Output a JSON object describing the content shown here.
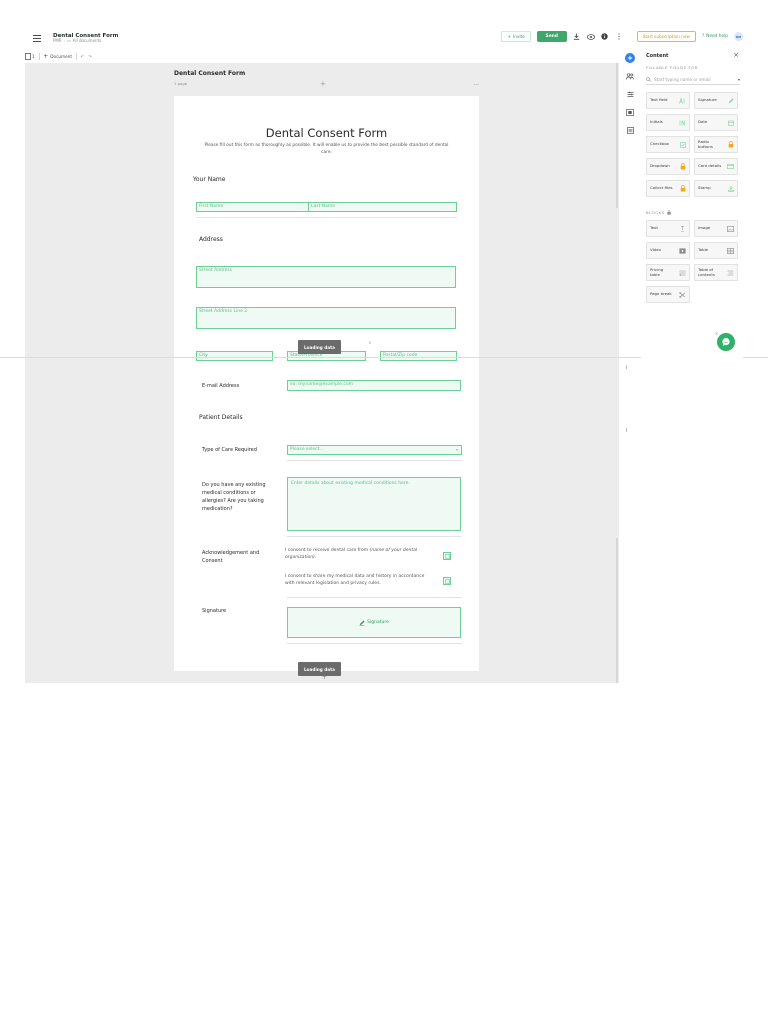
{
  "app": {
    "doc_title": "Dental Consent Form",
    "breadcrumb": [
      "PMR",
      "All documents"
    ]
  },
  "topbar": {
    "invite_label": "Invite",
    "send_label": "Send",
    "subscribe_label": "Start subscription now",
    "help_label": "Need help",
    "avatar_initials": "NH",
    "icons": [
      "download-icon",
      "preview-icon",
      "info-icon",
      "more-vert-icon"
    ]
  },
  "toolbar": {
    "pages_count": "1",
    "document_label": "Document"
  },
  "canvas": {
    "doc_name": "Dental Consent Form",
    "page_count_label": "1 page",
    "loading_label": "Loading data"
  },
  "form": {
    "title": "Dental Consent Form",
    "description": "Please fill out this form as thoroughly as possible. It will enable us to provide the best possible standard of dental care.",
    "your_name_label": "Your Name",
    "first_name_ph": "First Name",
    "last_name_ph": "Last Name",
    "address_label": "Address",
    "street_ph": "Street Address",
    "street2_ph": "Street Address Line 2",
    "city_ph": "City",
    "state_ph": "State/Province",
    "zip_ph": "Postal/Zip code",
    "email_label": "E-mail Address",
    "email_ph": "ex: myname@example.com",
    "patient_details_label": "Patient Details",
    "care_label": "Type of Care Required",
    "care_ph": "Please select...",
    "conditions_label": "Do you have any existing medical conditions or allergies? Are you taking medication?",
    "conditions_ph": "Enter details about existing medical conditions here.",
    "ack_label": "Acknowledgement and Consent",
    "consent_1_prefix": "I consent to receive dental care from",
    "consent_1_italic": "(name of your dental organization)",
    "consent_1_suffix": ".",
    "consent_2": "I consent to share my medical data and history in accordance with relevant legislation and privacy rules.",
    "signature_label": "Signature",
    "signature_field": "Signature"
  },
  "panel": {
    "title": "Content",
    "fillable_heading": "FILLABLE FIELDS FOR",
    "search_ph": "Start typing name or email",
    "blocks_heading": "BLOCKS",
    "fields": [
      {
        "label": "Text field",
        "icon": "text-field-icon"
      },
      {
        "label": "Signature",
        "icon": "signature-icon"
      },
      {
        "label": "Initials",
        "icon": "initials-icon"
      },
      {
        "label": "Date",
        "icon": "date-icon"
      },
      {
        "label": "Checkbox",
        "icon": "checkbox-icon"
      },
      {
        "label": "Radio buttons",
        "icon": "lock-icon"
      },
      {
        "label": "Dropdown",
        "icon": "lock-icon"
      },
      {
        "label": "Card details",
        "icon": "card-icon"
      },
      {
        "label": "Collect files",
        "icon": "lock-icon"
      },
      {
        "label": "Stamp",
        "icon": "stamp-icon"
      }
    ],
    "blocks": [
      {
        "label": "Text",
        "icon": "text-block-icon"
      },
      {
        "label": "Image",
        "icon": "image-icon"
      },
      {
        "label": "Video",
        "icon": "video-icon"
      },
      {
        "label": "Table",
        "icon": "table-icon"
      },
      {
        "label": "Pricing table",
        "icon": "pricing-table-icon"
      },
      {
        "label": "Table of contents",
        "icon": "toc-icon"
      },
      {
        "label": "Page break",
        "icon": "page-break-icon"
      }
    ]
  },
  "colors": {
    "accent_green": "#3fa76b",
    "field_border": "#6ccf95",
    "field_fill": "#eefaf3",
    "subscribe_orange": "#f0b33f",
    "rail_active_blue": "#2f80ed",
    "canvas_bg": "#ececec",
    "lock_orange": "#f2a91b"
  }
}
